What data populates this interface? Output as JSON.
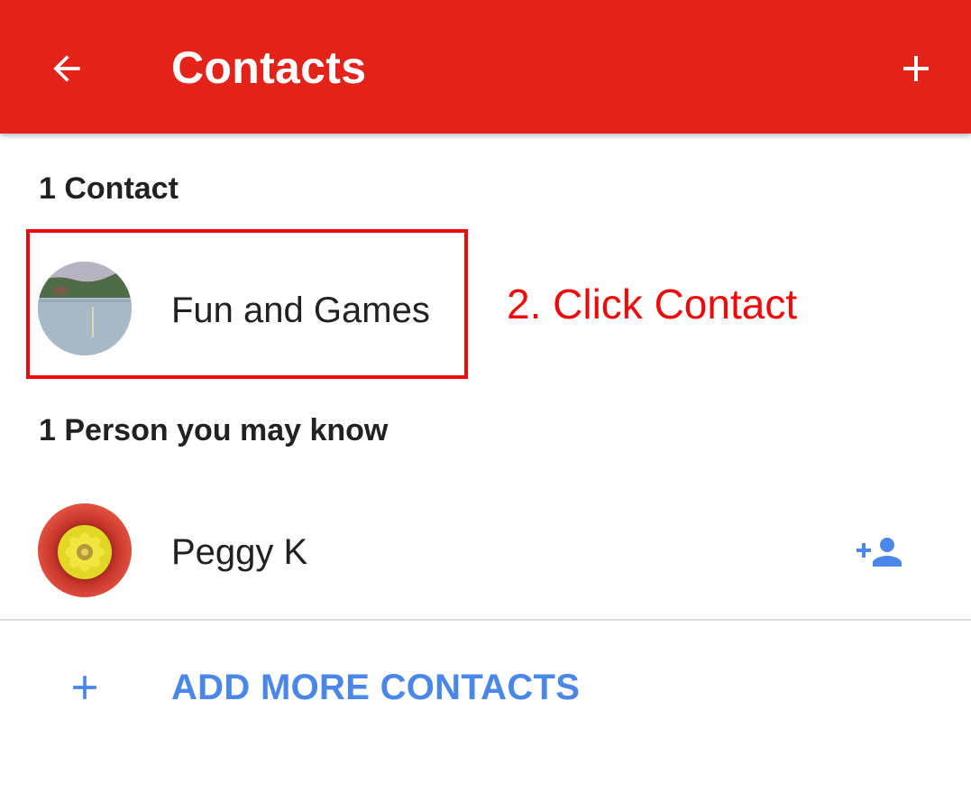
{
  "app_bar": {
    "title": "Contacts",
    "back_icon": "arrow-back-icon",
    "add_icon": "plus-icon",
    "color": "#e3221a"
  },
  "sections": {
    "contacts": {
      "header": "1 Contact",
      "items": [
        {
          "name": "Fun and Games",
          "avatar": "lake-landscape-photo"
        }
      ]
    },
    "suggestions": {
      "header": "1 Person you may know",
      "items": [
        {
          "name": "Peggy K",
          "avatar": "red-yellow-flower-photo",
          "action_icon": "add-person-icon"
        }
      ]
    }
  },
  "annotation": {
    "text": "2. Click Contact",
    "color": "#ee0a0a"
  },
  "add_more": {
    "label": "ADD MORE CONTACTS",
    "icon": "plus-icon",
    "color": "#4a87e8"
  }
}
